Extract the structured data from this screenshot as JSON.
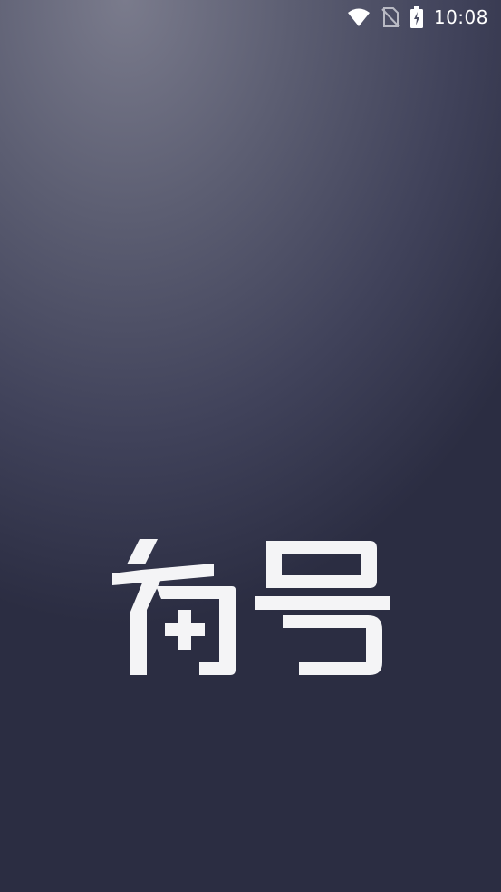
{
  "status_bar": {
    "time": "10:08",
    "icons": [
      "wifi-icon",
      "no-sim-icon",
      "battery-charging-icon"
    ]
  },
  "splash": {
    "logo_text": "有号",
    "logo_color": "#f4f4f6"
  },
  "colors": {
    "background_top": "#7a7b8c",
    "background_bottom": "#2b2d42"
  }
}
